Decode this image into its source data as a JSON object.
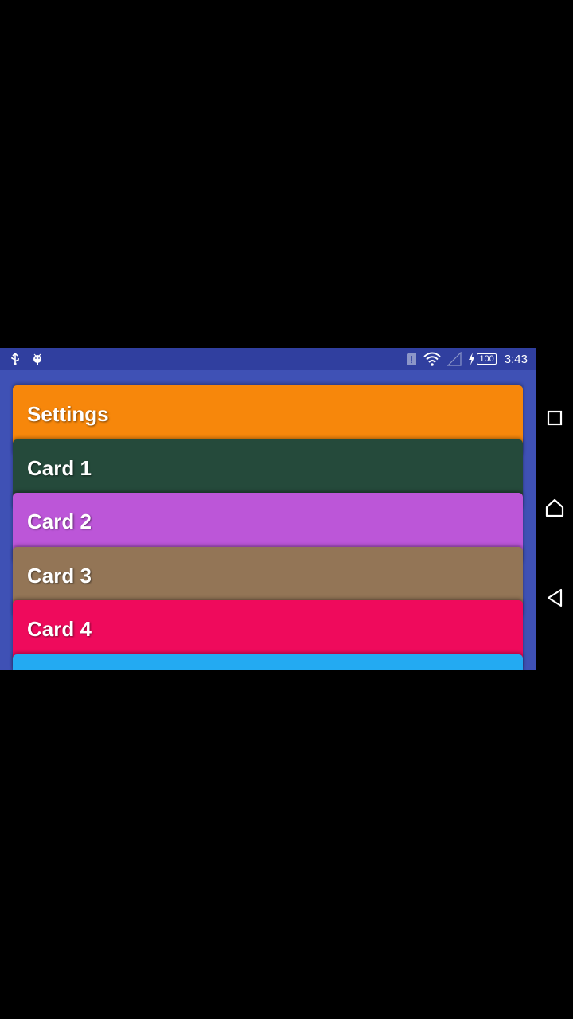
{
  "status_bar": {
    "left_icons": [
      "usb-icon",
      "android-debug-icon"
    ],
    "right_icons": [
      "sim-alert-icon",
      "wifi-icon",
      "cell-signal-icon",
      "charging-icon"
    ],
    "battery_level": "100",
    "time": "3:43",
    "color": "#303f9f"
  },
  "app": {
    "background": "#3f51b5"
  },
  "cards": [
    {
      "title": "Settings",
      "color": "#f7870b"
    },
    {
      "title": "Card 1",
      "color": "#254a3b"
    },
    {
      "title": "Card 2",
      "color": "#bc56d8"
    },
    {
      "title": "Card 3",
      "color": "#937556"
    },
    {
      "title": "Card 4",
      "color": "#ef0a5c"
    },
    {
      "title": "",
      "color": "#23aaf2"
    }
  ],
  "nav_bar": {
    "buttons": [
      "recents-icon",
      "home-icon",
      "back-icon"
    ]
  }
}
